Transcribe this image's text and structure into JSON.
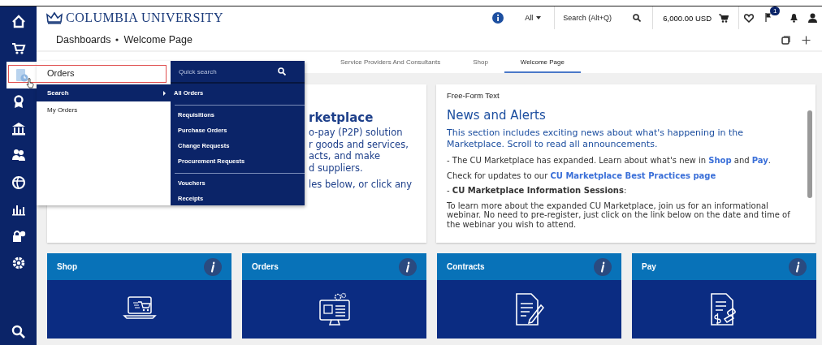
{
  "header": {
    "logo_text": "COLUMBIA UNIVERSITY",
    "scope": "All",
    "search": {
      "placeholder": "Search (Alt+Q)"
    },
    "cart_total": "6,000.00 USD",
    "notification_count": "1"
  },
  "sidebar": {
    "items": [
      {
        "kind": "home",
        "selected": false
      },
      {
        "kind": "cart",
        "selected": false
      },
      {
        "kind": "orders",
        "selected": true
      },
      {
        "kind": "award",
        "selected": false
      },
      {
        "kind": "bank",
        "selected": false
      },
      {
        "kind": "people",
        "selected": false
      },
      {
        "kind": "globe",
        "selected": false
      },
      {
        "kind": "chart",
        "selected": false
      },
      {
        "kind": "lock",
        "selected": false
      },
      {
        "kind": "gear",
        "selected": false
      }
    ]
  },
  "breadcrumb": [
    "Dashboards",
    "Welcome Page"
  ],
  "tabs": [
    {
      "label": "Service Providers And Consultants",
      "selected": false
    },
    {
      "label": "Shop",
      "selected": false
    },
    {
      "label": "Welcome Page",
      "selected": true
    }
  ],
  "flyout": {
    "title": "Orders",
    "items": [
      {
        "label": "Search",
        "selected": true
      },
      {
        "label": "My Orders",
        "selected": false
      }
    ],
    "submenu": {
      "search": {
        "placeholder": "Quick search"
      },
      "groups": [
        [
          "All Orders"
        ],
        [
          "Requisitions",
          "Purchase Orders",
          "Change Requests",
          "Procurement Requests"
        ],
        [
          "Vouchers",
          "Receipts"
        ]
      ]
    }
  },
  "welcome_card": {
    "heading": "rketplace",
    "lines": [
      "o-pay (P2P) solution",
      "r goods and services,",
      "acts, and make",
      "d suppliers."
    ],
    "note": "les below, or click any"
  },
  "news_card": {
    "label": "Free-Form Text",
    "heading": "News and Alerts",
    "intro": "This section includes exciting news about what's happening in the Marketplace. Scroll to read all announcements.",
    "paragraphs": [
      [
        {
          "kind": "plain",
          "text": "- The CU Marketplace has expanded.  Learn about what's new in "
        },
        {
          "kind": "link",
          "text": "Shop"
        },
        {
          "kind": "plain",
          "text": " and "
        },
        {
          "kind": "link",
          "text": "Pay"
        },
        {
          "kind": "plain",
          "text": "."
        }
      ],
      [
        {
          "kind": "plain",
          "text": "Check for updates to our "
        },
        {
          "kind": "link",
          "text": "CU Marketplace Best Practices page"
        }
      ],
      [
        {
          "kind": "plain",
          "text": "- **CU Marketplace Information Sessions**:"
        }
      ],
      [
        {
          "kind": "plain",
          "text": "To learn more about the expanded CU Marketplace, join us for an informational webinar.  No need to pre-register, just click on the link below on the date and time of the webinar you wish to attend."
        }
      ]
    ]
  },
  "tiles": [
    {
      "title": "Shop",
      "kind": "shop"
    },
    {
      "title": "Orders",
      "kind": "orders"
    },
    {
      "title": "Contracts",
      "kind": "contracts"
    },
    {
      "title": "Pay",
      "kind": "pay"
    }
  ]
}
